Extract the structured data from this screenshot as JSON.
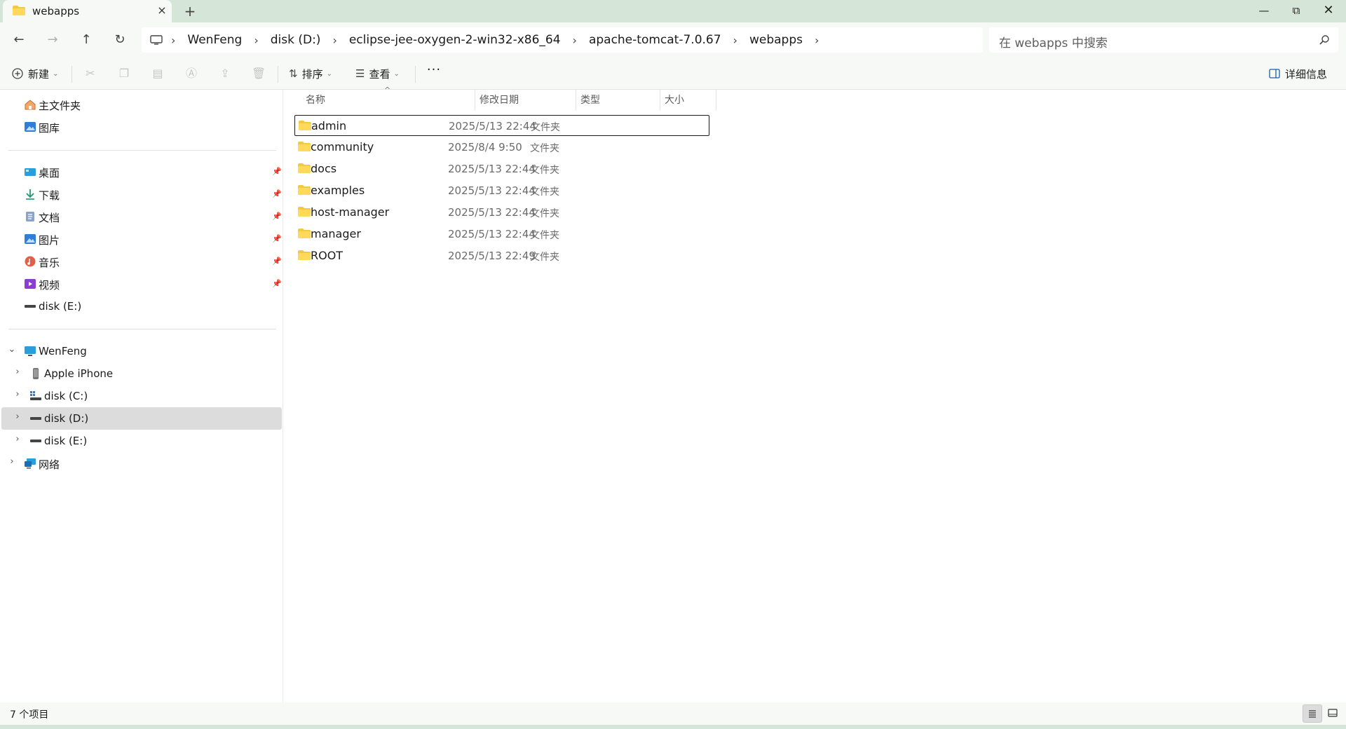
{
  "tab": {
    "title": "webapps",
    "close_icon": "×",
    "new_tab_icon": "+"
  },
  "window_controls": {
    "minimize": "—",
    "maximize": "⧉",
    "close": "✕"
  },
  "nav": {
    "back": "←",
    "forward": "→",
    "up": "↑",
    "refresh": "↻"
  },
  "breadcrumb": [
    "WenFeng",
    "disk (D:)",
    "eclipse-jee-oxygen-2-win32-x86_64",
    "apache-tomcat-7.0.67",
    "webapps"
  ],
  "breadcrumb_sep": "›",
  "search": {
    "placeholder": "在 webapps 中搜索"
  },
  "commands": {
    "new": "新建",
    "sort": "排序",
    "view": "查看",
    "more": "···",
    "details": "详细信息",
    "disabled_icons": [
      "cut-icon",
      "copy-icon",
      "paste-icon",
      "rename-icon",
      "share-icon",
      "delete-icon"
    ]
  },
  "sidebar": {
    "quick": [
      {
        "label": "主文件夹",
        "icon": "home-icon"
      },
      {
        "label": "图库",
        "icon": "gallery-icon"
      }
    ],
    "pinned": [
      {
        "label": "桌面",
        "icon": "desktop-icon"
      },
      {
        "label": "下载",
        "icon": "download-icon"
      },
      {
        "label": "文档",
        "icon": "document-icon"
      },
      {
        "label": "图片",
        "icon": "pictures-icon"
      },
      {
        "label": "音乐",
        "icon": "music-icon"
      },
      {
        "label": "视频",
        "icon": "videos-icon"
      },
      {
        "label": "disk (E:)",
        "icon": "drive-icon"
      }
    ],
    "tree": [
      {
        "label": "WenFeng",
        "icon": "pc-icon",
        "expanded": true
      },
      {
        "label": "Apple iPhone",
        "icon": "phone-icon"
      },
      {
        "label": "disk (C:)",
        "icon": "system-drive-icon"
      },
      {
        "label": "disk (D:)",
        "icon": "drive-icon",
        "selected": true
      },
      {
        "label": "disk (E:)",
        "icon": "drive-icon"
      },
      {
        "label": "网络",
        "icon": "network-icon"
      }
    ]
  },
  "columns": [
    "名称",
    "修改日期",
    "类型",
    "大小"
  ],
  "files": [
    {
      "name": "admin",
      "date": "2025/5/13 22:44",
      "type": "文件夹",
      "focused": true
    },
    {
      "name": "community",
      "date": "2025/8/4 9:50",
      "type": "文件夹"
    },
    {
      "name": "docs",
      "date": "2025/5/13 22:44",
      "type": "文件夹"
    },
    {
      "name": "examples",
      "date": "2025/5/13 22:44",
      "type": "文件夹"
    },
    {
      "name": "host-manager",
      "date": "2025/5/13 22:44",
      "type": "文件夹"
    },
    {
      "name": "manager",
      "date": "2025/5/13 22:44",
      "type": "文件夹"
    },
    {
      "name": "ROOT",
      "date": "2025/5/13 22:49",
      "type": "文件夹"
    }
  ],
  "status": {
    "count": "7 个项目"
  },
  "colors": {
    "chrome": "#f7f9f7",
    "accent_strip": "#d5e5d8",
    "folder": "#f5c842",
    "selected": "#dcdcdc"
  }
}
